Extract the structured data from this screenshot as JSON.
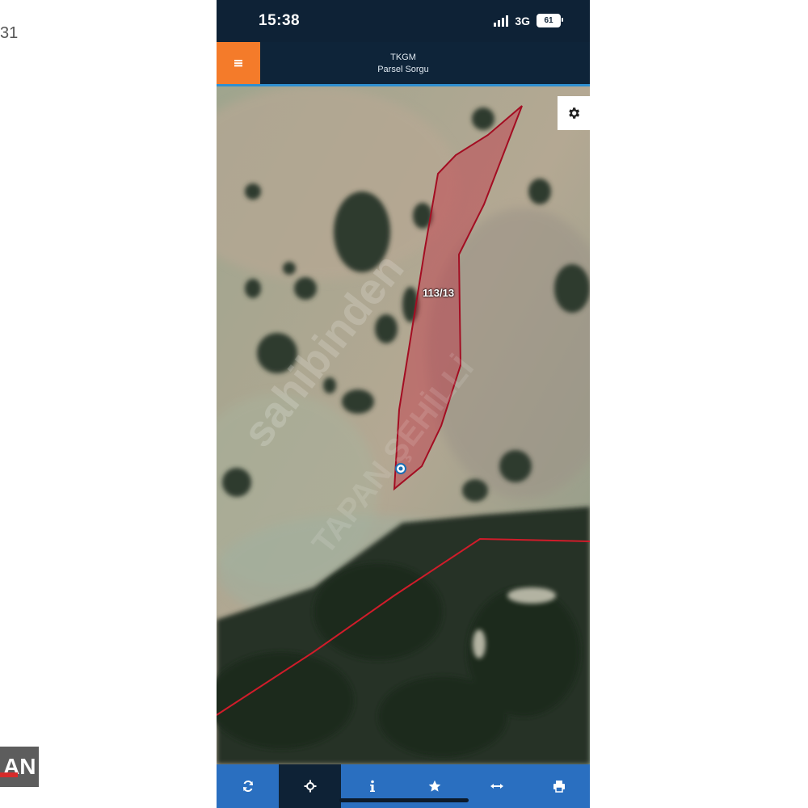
{
  "edge": {
    "left_number": "31",
    "logo_text": "AN"
  },
  "status_bar": {
    "time": "15:38",
    "network": "3G",
    "battery": "61"
  },
  "app_bar": {
    "title_line1": "TKGM",
    "title_line2": "Parsel Sorgu"
  },
  "map": {
    "parcel_label": "113/13",
    "watermark": "sahibinden",
    "watermark2": "TAPAN ŞEHİLLİ",
    "parcel_color": "#c8102e",
    "boundary_color": "#d01c2a"
  },
  "toolbar": {
    "items": [
      {
        "icon": "refresh-icon"
      },
      {
        "icon": "locate-icon"
      },
      {
        "icon": "info-icon"
      },
      {
        "icon": "star-icon"
      },
      {
        "icon": "measure-icon"
      },
      {
        "icon": "print-icon"
      }
    ],
    "active_index": 1
  },
  "colors": {
    "menu_button": "#f47b2a",
    "app_bar": "#0e2439",
    "toolbar": "#2a6fc0"
  }
}
